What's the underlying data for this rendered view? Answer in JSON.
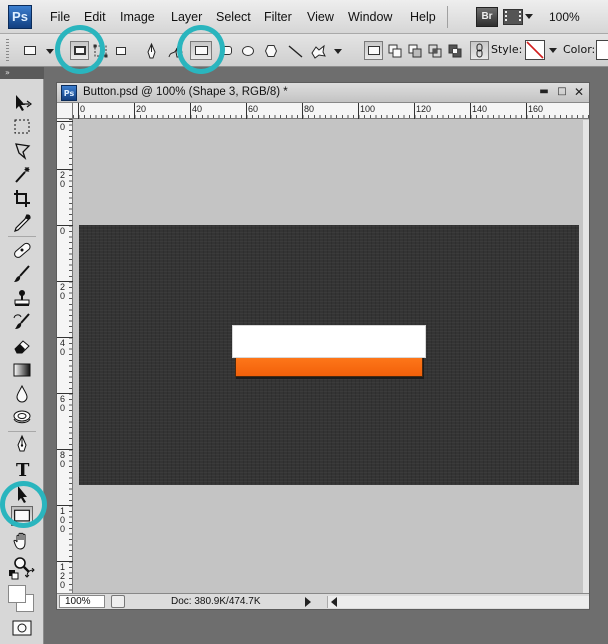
{
  "app": {
    "logo_text": "Ps",
    "bridge_text": "Br",
    "zoom": "100%"
  },
  "menu": {
    "items": [
      "File",
      "Edit",
      "Image",
      "Layer",
      "Select",
      "Filter",
      "View",
      "Window",
      "Help"
    ]
  },
  "options_bar": {
    "style_label": "Style:",
    "color_label": "Color:",
    "icons": [
      "rectangle-icon",
      "shape-layers-icon",
      "paths-icon",
      "fill-pixels-icon",
      "pen-icon",
      "freeform-pen-icon",
      "rectangle-icon",
      "rounded-rectangle-icon",
      "ellipse-icon",
      "polygon-icon",
      "line-icon",
      "custom-shape-icon",
      "new-layer-icon",
      "add-icon",
      "subtract-icon",
      "intersect-icon",
      "exclude-icon",
      "link-icon"
    ],
    "selected": [
      "shape-layers",
      "rectangle-tool"
    ]
  },
  "tools": {
    "icons": [
      "move-icon",
      "marquee-icon",
      "lasso-icon",
      "magic-wand-icon",
      "crop-icon",
      "eyedropper-icon",
      "healing-icon",
      "brush-icon",
      "stamp-icon",
      "history-brush-icon",
      "eraser-icon",
      "gradient-icon",
      "blur-icon",
      "dodge-icon",
      "pen-icon",
      "type-icon",
      "path-selection-icon",
      "rectangle-icon",
      "hand-icon",
      "zoom-icon"
    ],
    "active": "rectangle-icon"
  },
  "document": {
    "logo_text": "Ps",
    "title": "Button.psd @ 100% (Shape 3, RGB/8) *",
    "ruler_h": [
      "0",
      "20",
      "40",
      "60",
      "80",
      "100",
      "120",
      "140",
      "160"
    ],
    "ruler_v": [
      "0",
      "2 0",
      "0",
      "2 0",
      "4 0",
      "6 0",
      "8 0",
      "1 0 0",
      "1 2 0"
    ],
    "zoom": "100%",
    "doc_info": "Doc: 380.9K/474.7K"
  },
  "colors": {
    "accent": "#2ab5be",
    "button_orange": "#f76a12",
    "canvas_dark": "#343434"
  }
}
